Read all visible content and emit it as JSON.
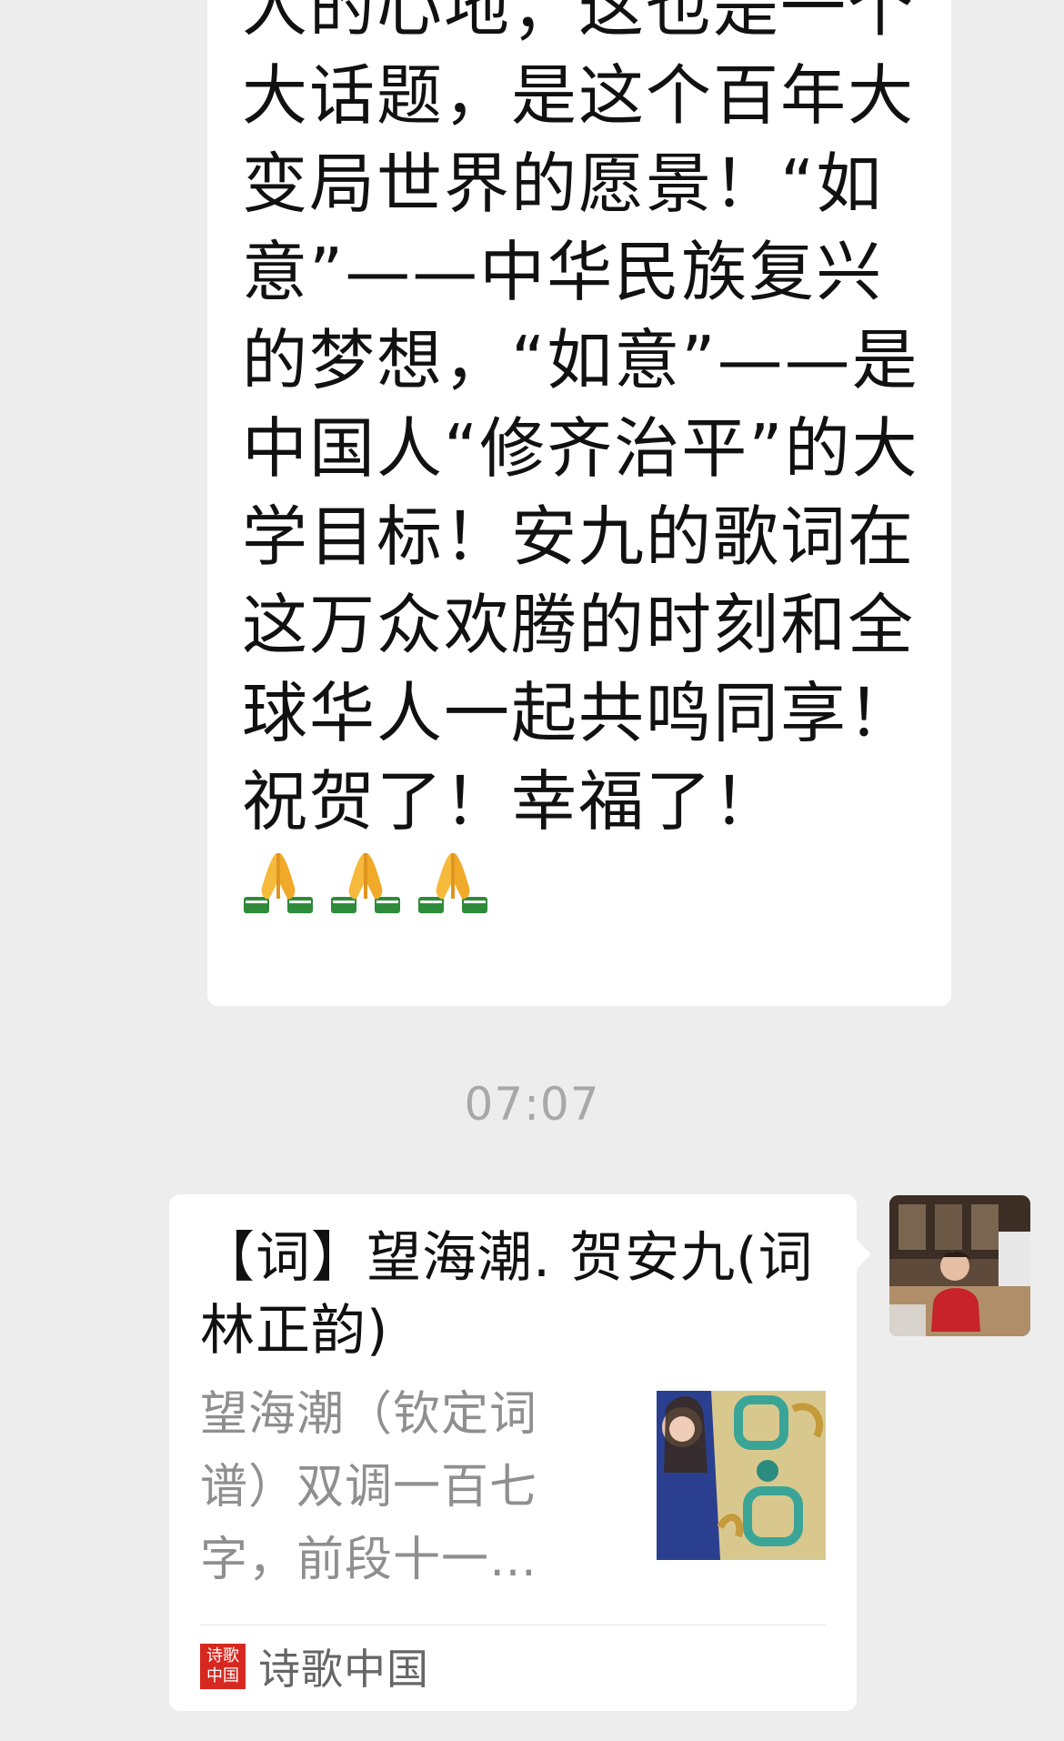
{
  "messages": {
    "incoming_text": "人的心地；这也是一个大话题，是这个百年大变局世界的愿景！“如意”——中华民族复兴的梦想，“如意”——是中国人“修齐治平”的大学目标！安九的歌词在这万众欢腾的时刻和全球华人一起共鸣同享！祝贺了！幸福了！",
    "emoji_count": 3
  },
  "timestamp": "07:07",
  "link_card": {
    "title": "【词】望海潮. 贺安九(词林正韵)",
    "description": "望海潮（钦定词谱）双调一百七字，前段十一…",
    "source_name": "诗歌中国",
    "source_logo_text": "诗歌中国"
  },
  "colors": {
    "background": "#ededed",
    "bubble": "#ffffff",
    "timestamp": "#a8a8a8",
    "logo_red": "#d72820"
  }
}
